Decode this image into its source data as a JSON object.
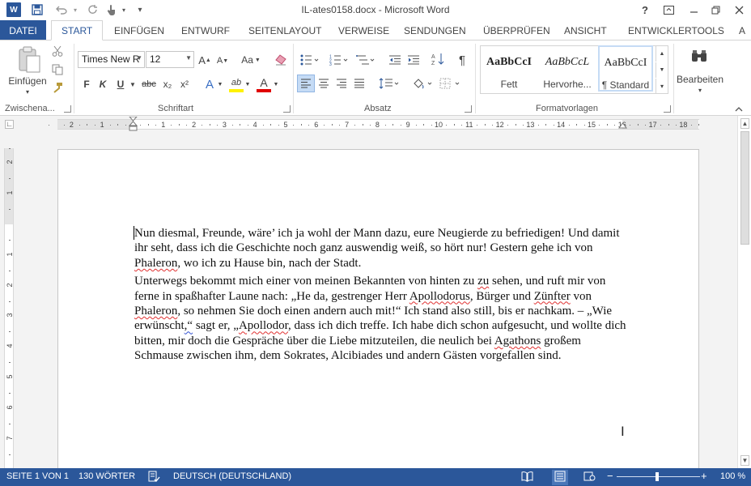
{
  "window": {
    "title": "IL-ates0158.docx - Microsoft Word",
    "app_icon": "W",
    "help": "?",
    "quick_access": {
      "save": "save-icon",
      "undo": "undo-icon",
      "redo": "redo-icon",
      "touch": "touch-mode-icon",
      "customize": "▾"
    }
  },
  "tabs": {
    "file": "DATEI",
    "items": [
      "START",
      "EINFÜGEN",
      "ENTWURF",
      "SEITENLAYOUT",
      "VERWEISE",
      "SENDUNGEN",
      "ÜBERPRÜFEN",
      "ANSICHT",
      "ENTWICKLERTOOLS",
      "A"
    ]
  },
  "ribbon": {
    "clipboard": {
      "paste_label": "Einfügen",
      "group_label": "Zwischena..."
    },
    "font": {
      "font_name": "Times New R",
      "font_size": "12",
      "grow": "A",
      "shrink": "A",
      "case": "Aa",
      "bold": "F",
      "italic": "K",
      "underline": "U",
      "strike": "abc",
      "sub": "x₂",
      "sup": "x²",
      "effects": "A",
      "highlight": "ab",
      "font_color": "A",
      "group_label": "Schriftart"
    },
    "paragraph": {
      "pilcrow": "¶",
      "group_label": "Absatz"
    },
    "styles": {
      "items": [
        {
          "preview": "AaBbCcI",
          "name": "Fett"
        },
        {
          "preview": "AaBbCcL",
          "name": "Hervorhe..."
        },
        {
          "preview": "AaBbCcI",
          "name": "¶ Standard"
        }
      ],
      "group_label": "Formatvorlagen"
    },
    "editing": {
      "label": "Bearbeiten"
    }
  },
  "ruler": {
    "ticks": [
      "2",
      "1",
      "1",
      "2",
      "3",
      "4",
      "5",
      "6",
      "7",
      "8",
      "9",
      "10",
      "11",
      "12",
      "13",
      "14",
      "15",
      "16",
      "17",
      "18"
    ],
    "vticks": [
      "2",
      "1",
      "1",
      "2",
      "3",
      "4",
      "5",
      "6",
      "7"
    ]
  },
  "document": {
    "p1": "Nun diesmal, Freunde, wäre’ ich ja wohl der Mann dazu, eure Neugierde zu befriedigen! Und damit ihr seht, dass ich die Geschichte noch ganz auswendig weiß, so hört nur! Gestern gehe ich von ",
    "p1_phaleron": "Phaleron",
    "p1_end": ", wo ich zu Hause bin, nach der Stadt.",
    "p2_a": "Unterwegs bekommt mich einer von meinen Bekannten von hinten zu ",
    "p2_zu": "zu",
    "p2_b": " sehen, und ruft mir von ferne in spaßhafter Laune nach: „He da, gestrenger Herr ",
    "p2_apollodorus": "Apollodorus",
    "p2_c": ", Bürger und ",
    "p2_zunfter": "Zünfter",
    "p2_d": " von ",
    "p2_phaleron": "Phaleron",
    "p2_e": ", so nehmen Sie doch einen andern auch mit!“ Ich stand also still, bis er nachkam. – „Wie erwünscht",
    "p2_comma": ",“",
    "p2_f": " sagt er, „",
    "p2_apollodor": "Apollodor",
    "p2_g": ", dass ich dich treffe. Ich habe dich schon aufgesucht, und wollte dich bitten, mir doch die Gespräche über die Liebe mitzuteilen, die neulich bei ",
    "p2_agathons": "Agathons",
    "p2_h": " großem Schmause zwischen ihm, dem Sokrates, Alcibiades und andern Gästen vorgefallen sind."
  },
  "status": {
    "page": "SEITE 1 VON 1",
    "words": "130 WÖRTER",
    "language": "DEUTSCH (DEUTSCHLAND)",
    "zoom_minus": "−",
    "zoom_plus": "+",
    "zoom": "100 %"
  }
}
